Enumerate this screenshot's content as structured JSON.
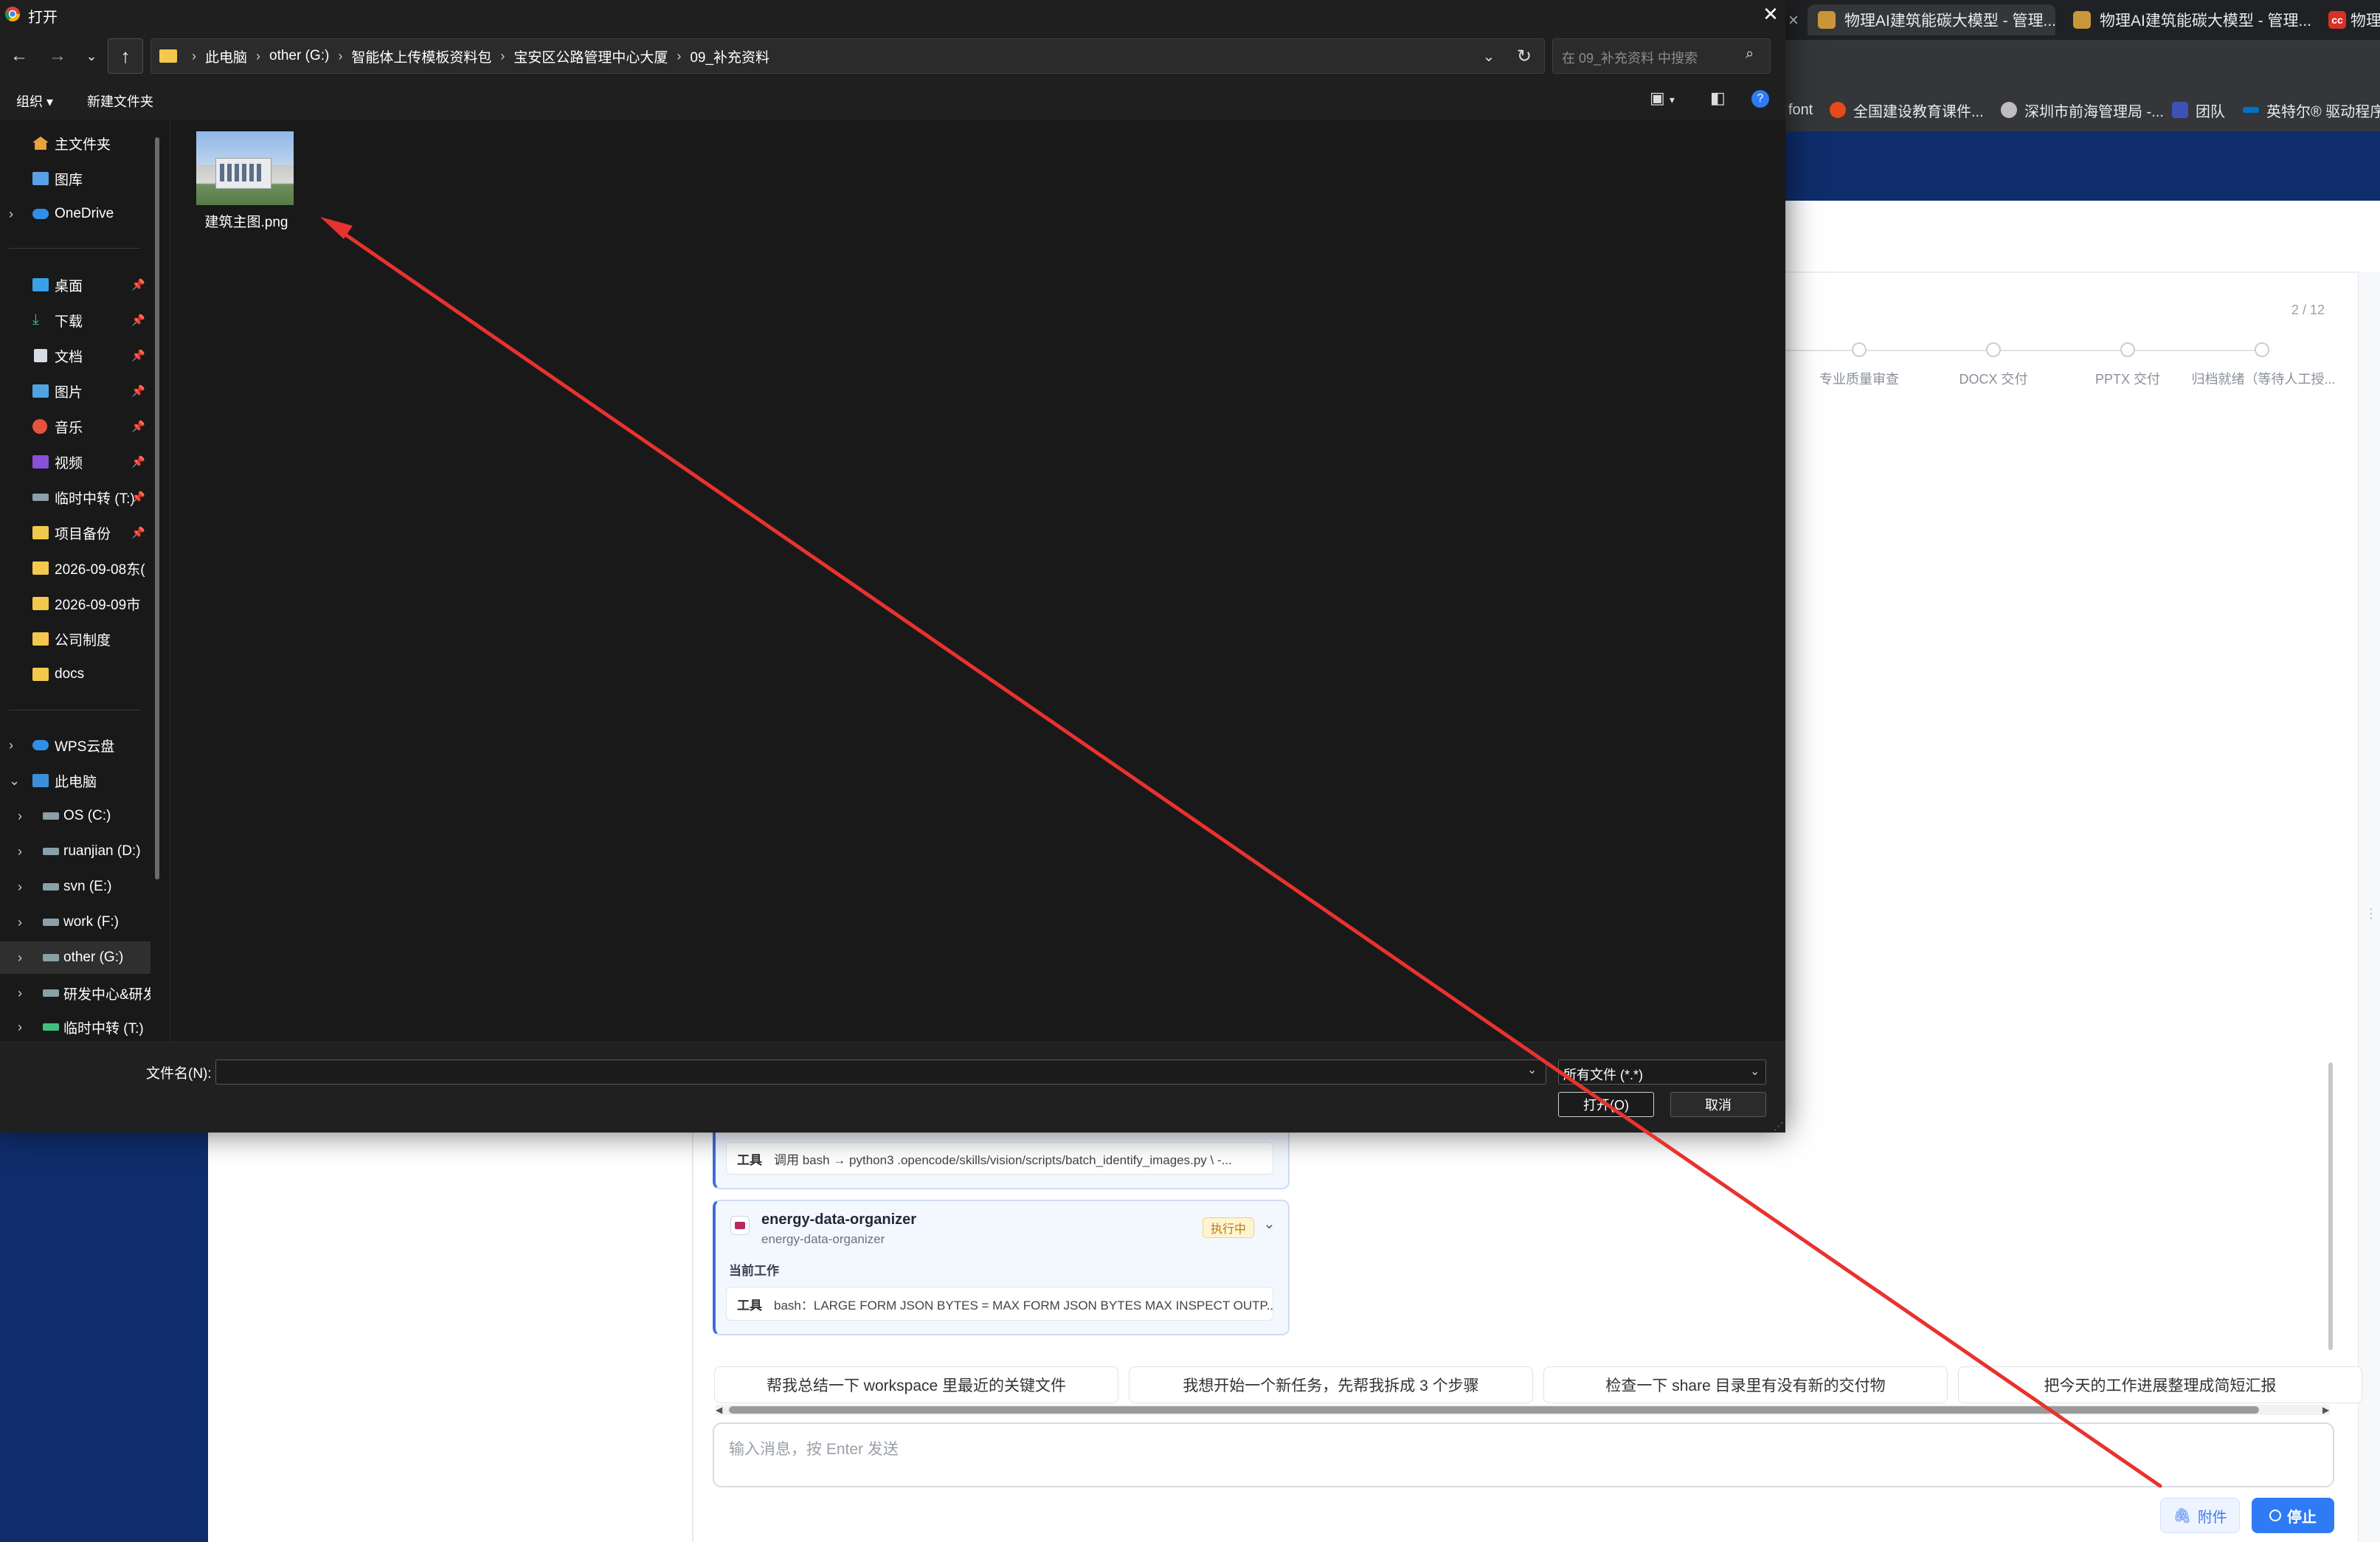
{
  "browser": {
    "tabs": [
      {
        "label": "物理AI建筑能碳大模型 - 管理...",
        "active": true
      },
      {
        "label": "物理AI建筑能碳大模型 - 管理...",
        "active": false
      },
      {
        "label": "物理",
        "active": false
      }
    ],
    "bookmarks": [
      "font",
      "全国建设教育课件...",
      "深圳市前海管理局 -...",
      "团队",
      "英特尔® 驱动程序..."
    ]
  },
  "app": {
    "steps_count": "2 / 12",
    "steps": [
      "专业质量审查",
      "DOCX 交付",
      "PPTX 交付",
      "归档就绪（等待人工授..."
    ],
    "card1": {
      "tool_label": "工具",
      "tool_text": "调用 bash → python3 .opencode/skills/vision/scripts/batch_identify_images.py \\ -..."
    },
    "card2": {
      "title": "energy-data-organizer",
      "subtitle": "energy-data-organizer",
      "badge": "执行中",
      "section": "当前工作",
      "tool_label": "工具",
      "tool_text": "bash：LARGE FORM JSON BYTES = MAX FORM JSON BYTES MAX INSPECT OUTP..."
    },
    "suggestions": [
      "帮我总结一下 workspace 里最近的关键文件",
      "我想开始一个新任务，先帮我拆成 3 个步骤",
      "检查一下 share 目录里有没有新的交付物",
      "把今天的工作进展整理成简短汇报"
    ],
    "input_placeholder": "输入消息，按 Enter 发送",
    "attach_label": "附件",
    "stop_label": "停止"
  },
  "dialog": {
    "title": "打开",
    "breadcrumb": [
      "此电脑",
      "other (G:)",
      "智能体上传模板资料包",
      "宝安区公路管理中心大厦",
      "09_补充资料"
    ],
    "search_placeholder": "在 09_补充资料 中搜索",
    "commands": {
      "organize": "组织 ▾",
      "new_folder": "新建文件夹"
    },
    "nav": {
      "home": "主文件夹",
      "gallery": "图库",
      "onedrive": "OneDrive",
      "quick": [
        {
          "label": "桌面",
          "pinned": true
        },
        {
          "label": "下载",
          "pinned": true
        },
        {
          "label": "文档",
          "pinned": true
        },
        {
          "label": "图片",
          "pinned": true
        },
        {
          "label": "音乐",
          "pinned": true
        },
        {
          "label": "视频",
          "pinned": true
        },
        {
          "label": "临时中转 (T:)",
          "pinned": true
        },
        {
          "label": "项目备份",
          "pinned": true
        },
        {
          "label": "2026-09-08东(",
          "pinned": false
        },
        {
          "label": "2026-09-09市",
          "pinned": false
        },
        {
          "label": "公司制度",
          "pinned": false
        },
        {
          "label": "docs",
          "pinned": false
        }
      ],
      "wps": "WPS云盘",
      "this_pc": "此电脑",
      "drives": [
        "OS (C:)",
        "ruanjian (D:)",
        "svn (E:)",
        "work (F:)",
        "other (G:)",
        "研发中心&研发",
        "临时中转 (T:)"
      ]
    },
    "file": {
      "name": "建筑主图.png"
    },
    "filename_label": "文件名(N):",
    "filename_value": "",
    "file_type": "所有文件 (*.*)",
    "open_label": "打开(O)",
    "cancel_label": "取消"
  },
  "colors": {
    "accent": "#2f7bf5",
    "annotation_arrow": "#e8322f",
    "app_navy": "#0f2d6b"
  }
}
